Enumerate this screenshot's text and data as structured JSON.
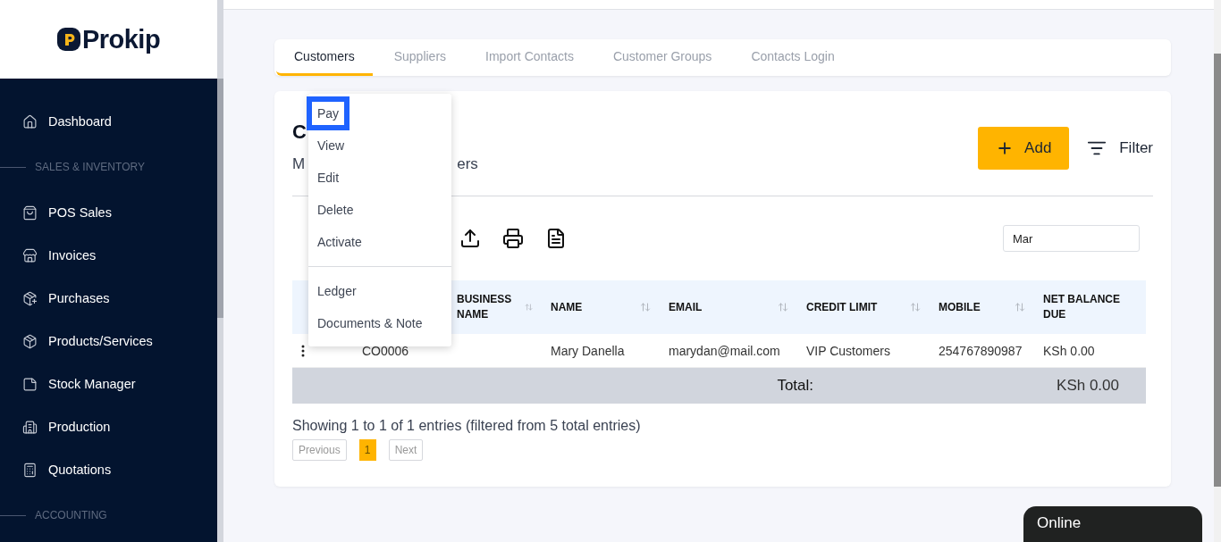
{
  "brand": {
    "name": "Prokip"
  },
  "sidebar": {
    "items": [
      {
        "kind": "link",
        "label": "Dashboard"
      },
      {
        "kind": "section",
        "label": "SALES & INVENTORY"
      },
      {
        "kind": "link",
        "label": "POS Sales"
      },
      {
        "kind": "link",
        "label": "Invoices"
      },
      {
        "kind": "link",
        "label": "Purchases"
      },
      {
        "kind": "link",
        "label": "Products/Services"
      },
      {
        "kind": "link",
        "label": "Stock Manager"
      },
      {
        "kind": "link",
        "label": "Production"
      },
      {
        "kind": "link",
        "label": "Quotations"
      },
      {
        "kind": "section",
        "label": "ACCOUNTING"
      }
    ]
  },
  "tabs": [
    {
      "label": "Customers",
      "selected": true
    },
    {
      "label": "Suppliers",
      "selected": false
    },
    {
      "label": "Import Contacts",
      "selected": false
    },
    {
      "label": "Customer Groups",
      "selected": false
    },
    {
      "label": "Contacts Login",
      "selected": false
    }
  ],
  "page": {
    "title": "C",
    "subtitle_start": "M",
    "subtitle_end": "ers"
  },
  "add_button": "Add",
  "filter_button": "Filter",
  "search": {
    "value": "Mar"
  },
  "table": {
    "columns": [
      "",
      "",
      "BUSINESS NAME",
      "NAME",
      "EMAIL",
      "CREDIT LIMIT",
      "MOBILE",
      "NET BALANCE DUE"
    ],
    "rows": [
      [
        "",
        "CO0006",
        "",
        "Mary Danella",
        "marydan@mail.com",
        "VIP Customers",
        "254767890987",
        "KSh 0.00"
      ]
    ],
    "total_label": "Total:",
    "total_value": "KSh 0.00"
  },
  "pagination": {
    "info": "Showing 1 to 1 of 1 entries (filtered from 5 total entries)",
    "previous": "Previous",
    "pages": [
      {
        "label": "1",
        "selected": true
      }
    ],
    "next": "Next"
  },
  "action_menu": {
    "items": [
      {
        "label": "Pay",
        "focused": true
      },
      {
        "label": "View",
        "focused": false
      },
      {
        "label": "Edit",
        "focused": false
      },
      {
        "label": "Delete",
        "focused": false
      },
      {
        "label": "Activate",
        "focused": false,
        "divider_after": true
      },
      {
        "label": "Ledger",
        "focused": false
      },
      {
        "label": "Documents & Note",
        "focused": false
      }
    ]
  },
  "chat": {
    "label": "Online"
  }
}
